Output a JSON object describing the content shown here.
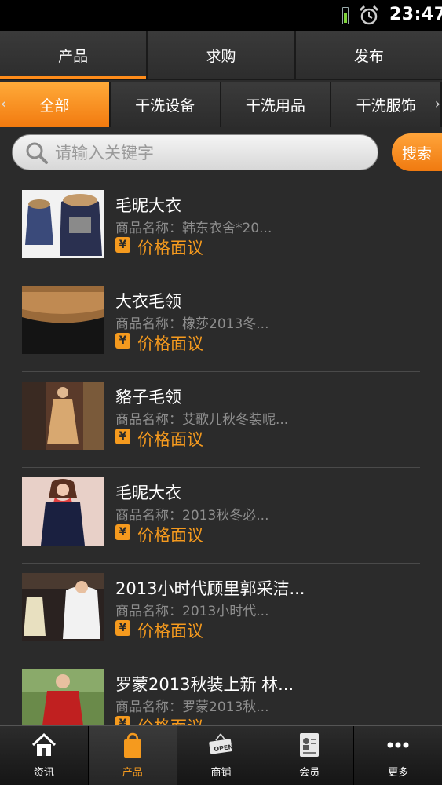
{
  "status_bar": {
    "time": "23:47"
  },
  "top_tabs": [
    {
      "label": "产品",
      "active": true
    },
    {
      "label": "求购",
      "active": false
    },
    {
      "label": "发布",
      "active": false
    }
  ],
  "categories": [
    {
      "label": "全部",
      "active": true
    },
    {
      "label": "干洗设备",
      "active": false
    },
    {
      "label": "干洗用品",
      "active": false
    },
    {
      "label": "干洗服饰",
      "active": false
    }
  ],
  "search": {
    "placeholder": "请输入关键字",
    "button_label": "搜索"
  },
  "products": [
    {
      "title": "毛昵大衣",
      "subtitle": "商品名称：韩东衣舍*20...",
      "price_symbol": "¥",
      "price": "价格面议"
    },
    {
      "title": "大衣毛领",
      "subtitle": "商品名称：橡莎2013冬...",
      "price_symbol": "¥",
      "price": "价格面议"
    },
    {
      "title": "貉子毛领",
      "subtitle": "商品名称：艾歌儿秋冬装昵...",
      "price_symbol": "¥",
      "price": "价格面议"
    },
    {
      "title": "毛昵大衣",
      "subtitle": "商品名称：2013秋冬必...",
      "price_symbol": "¥",
      "price": "价格面议"
    },
    {
      "title": "2013小时代顾里郭采洁...",
      "subtitle": "商品名称：2013小时代...",
      "price_symbol": "¥",
      "price": "价格面议"
    },
    {
      "title": "罗蒙2013秋装上新 林...",
      "subtitle": "商品名称：罗蒙2013秋...",
      "price_symbol": "¥",
      "price": "价格面议"
    }
  ],
  "bottom_nav": [
    {
      "label": "资讯",
      "icon": "home-icon",
      "active": false
    },
    {
      "label": "产品",
      "icon": "shopping-bag-icon",
      "active": true
    },
    {
      "label": "商铺",
      "icon": "open-sign-icon",
      "active": false
    },
    {
      "label": "会员",
      "icon": "member-card-icon",
      "active": false
    },
    {
      "label": "更多",
      "icon": "more-icon",
      "active": false
    }
  ],
  "colors": {
    "accent": "#f59a1e",
    "background": "#2b2b2b"
  }
}
